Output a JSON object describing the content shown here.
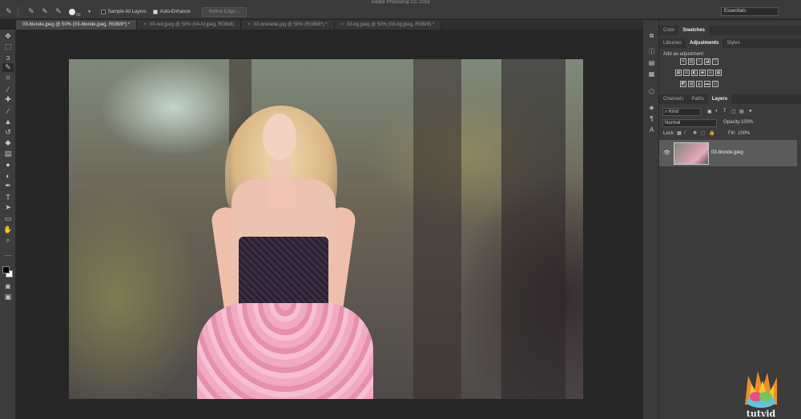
{
  "app": {
    "title": "Adobe Photoshop CC 2016"
  },
  "options_bar": {
    "brush_size": "50",
    "sample_all_layers": "Sample All Layers",
    "auto_enhance": "Auto-Enhance",
    "refine_edge": "Refine Edge...",
    "workspace": "Essentials"
  },
  "doc_tabs": [
    {
      "label": "03-blonde.jpeg @ 50% (03-blonde.jpeg, RGB/8*) *",
      "active": true
    },
    {
      "label": "03-red.jpeg @ 50% (04-IV.jpeg, RGB/8)",
      "active": false
    },
    {
      "label": "03-brunette.jpg @ 50% (RGB/8*) *",
      "active": false
    },
    {
      "label": "03-bg.jpeg @ 50% (03-bg.jpeg, RGB/8) *",
      "active": false
    }
  ],
  "panels": {
    "color_tabs": [
      "Color",
      "Swatches"
    ],
    "adjust_tabs": [
      "Libraries",
      "Adjustments",
      "Styles"
    ],
    "add_adjustment": "Add an adjustment",
    "layer_tabs": [
      "Channels",
      "Paths",
      "Layers"
    ],
    "kind": "Kind",
    "blend_mode": "Normal",
    "opacity_label": "Opacity:",
    "opacity_value": "100%",
    "lock_label": "Lock:",
    "fill_label": "Fill:",
    "fill_value": "100%",
    "layer_name": "03-blonde.jpeg"
  },
  "watermark": {
    "text": "tutvid"
  }
}
